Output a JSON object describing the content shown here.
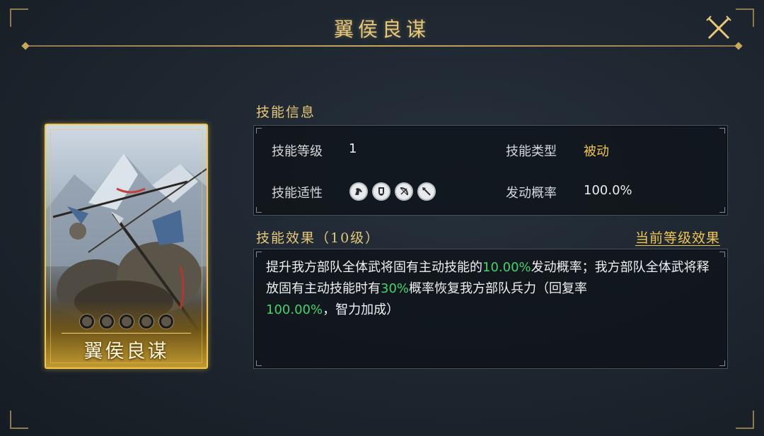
{
  "window": {
    "title": "翼侯良谋"
  },
  "card": {
    "name": "翼侯良谋",
    "level_dots": 5
  },
  "skill_info": {
    "section_title": "技能信息",
    "level_label": "技能等级",
    "level_value": "1",
    "type_label": "技能类型",
    "type_value": "被动",
    "fit_label": "技能适性",
    "fit_icons": [
      "cavalry-icon",
      "shield-icon",
      "bow-icon",
      "spear-icon"
    ],
    "rate_label": "发动概率",
    "rate_value": "100.0%"
  },
  "skill_effect": {
    "section_title": "技能效果（10级）",
    "current_level_link": "当前等级效果",
    "segments": [
      {
        "text": "提升我方部队全体武将固有主动技能的",
        "highlight": false
      },
      {
        "text": "10.00%",
        "highlight": true
      },
      {
        "text": "发动概率；我方部队全体武将释放固有主动技能时有",
        "highlight": false
      },
      {
        "text": "30%",
        "highlight": true
      },
      {
        "text": "概率恢复我方部队兵力（回复率",
        "highlight": false
      },
      {
        "text": "100.00%",
        "highlight": true
      },
      {
        "text": "，智力加成）",
        "highlight": false
      }
    ]
  },
  "colors": {
    "gold": "#f0c650",
    "highlight_green": "#3fd46b",
    "card_border": "#f1c64a"
  }
}
